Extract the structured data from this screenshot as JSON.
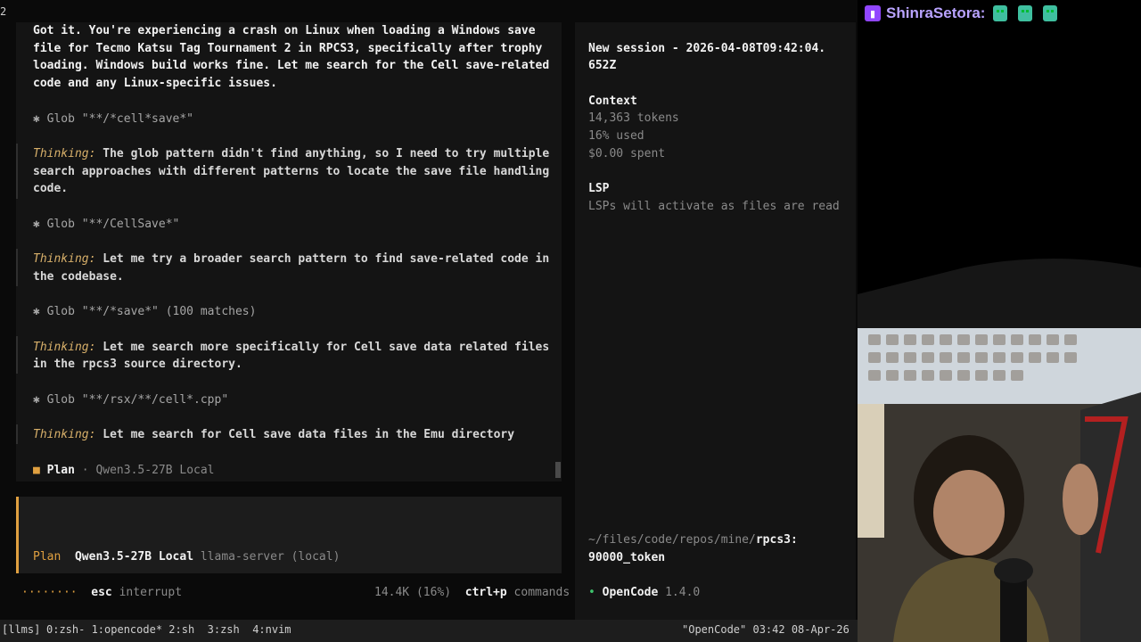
{
  "pane_number": "2",
  "chat": {
    "assistant_message": [
      "Got it. You're experiencing a crash on Linux when loading a Windows save",
      "file for Tecmo Katsu Tag Tournament 2 in RPCS3, specifically after trophy",
      "loading. Windows build works fine. Let me search for the Cell save-related",
      "code and any Linux-specific issues."
    ],
    "tool_1": "✱ Glob \"**/*cell*save*\"",
    "thinking_label": "Thinking:",
    "thinking_1": [
      " The glob pattern didn't find anything, so I need to try multiple",
      "search approaches with different patterns to locate the save file handling",
      "code."
    ],
    "tool_2": "✱ Glob \"**/CellSave*\"",
    "thinking_2": [
      " Let me try a broader search pattern to find save-related code in",
      "the codebase."
    ],
    "tool_3": "✱ Glob \"**/*save*\" (100 matches)",
    "thinking_3": [
      " Let me search more specifically for Cell save data related files",
      "in the rpcs3 source directory."
    ],
    "tool_4": "✱ Glob \"**/rsx/**/cell*.cpp\"",
    "thinking_4": " Let me search for Cell save data files in the Emu directory",
    "status_icon": "■",
    "status_mode": "Plan",
    "status_model": "· Qwen3.5-27B Local"
  },
  "input": {
    "mode": "Plan",
    "model": "Qwen3.5-27B Local",
    "provider": "llama-server (local)"
  },
  "footer": {
    "spinner": "········",
    "esc_key": "esc",
    "esc_label": "interrupt",
    "usage": "14.4K (16%)",
    "cmd_key": "ctrl+p",
    "cmd_label": "commands"
  },
  "sidebar": {
    "session_title_line1": "New session - 2026-04-08T09:42:04.",
    "session_title_line2": "652Z",
    "context_heading": "Context",
    "context_tokens": "14,363 tokens",
    "context_used": "16% used",
    "context_spent": "$0.00 spent",
    "lsp_heading": "LSP",
    "lsp_text": "LSPs will activate as files are read",
    "path_line1_prefix": "~/files/code/repos/mine/",
    "path_line1_repo": "rpcs3:",
    "path_line2": "90000_token",
    "app_dot": "•",
    "app_name": "OpenCode",
    "app_version": "1.4.0"
  },
  "tmux": {
    "session": "[llms]",
    "windows": "0:zsh- 1:opencode* 2:sh  3:zsh  4:nvim",
    "right": "\"OpenCode\" 03:42 08-Apr-26"
  },
  "stream_chat": {
    "username": "ShinraSetora:",
    "emote_color": "#3fbf9f"
  }
}
